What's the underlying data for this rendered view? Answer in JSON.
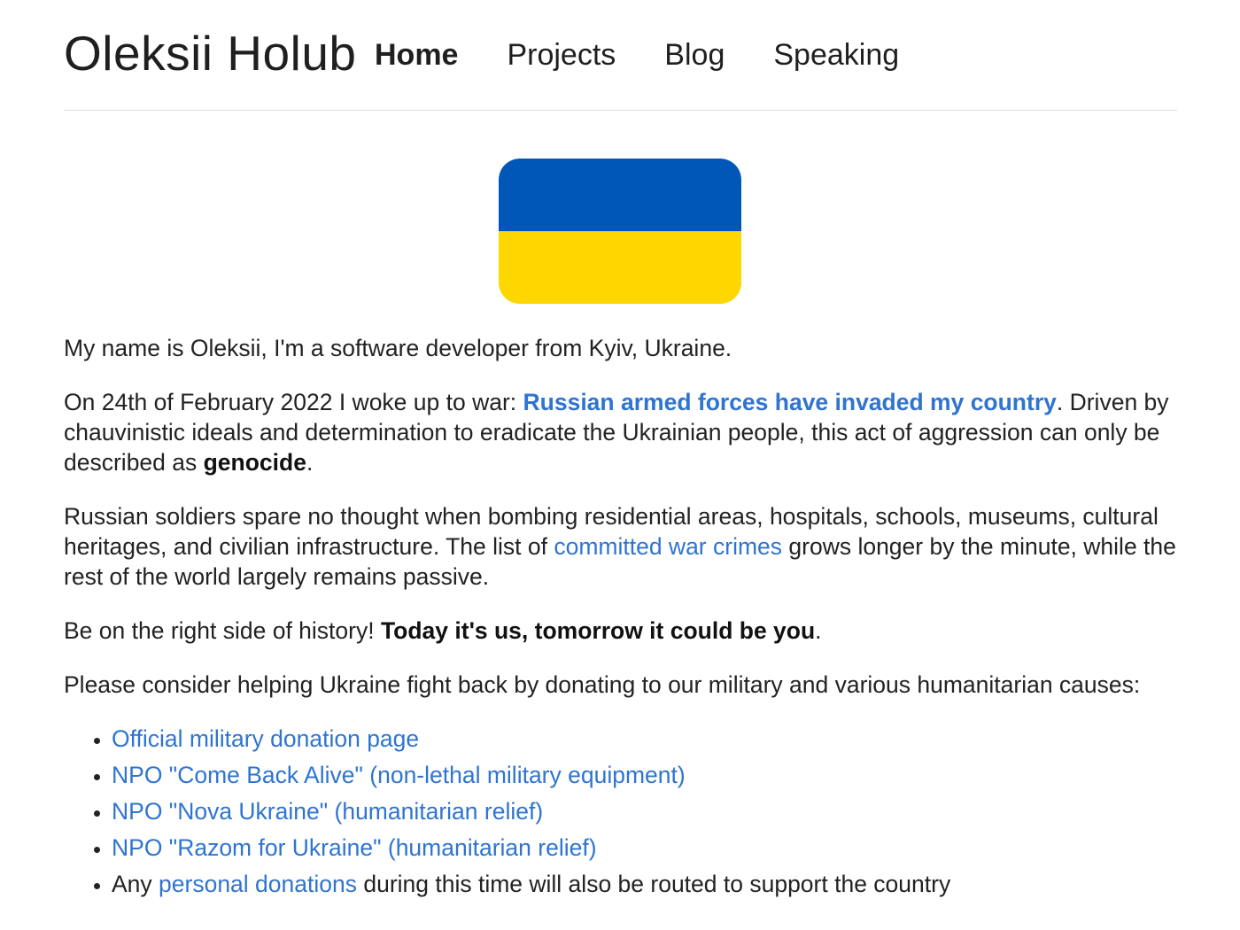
{
  "header": {
    "site_title": "Oleksii Holub",
    "nav": [
      {
        "label": "Home",
        "active": true
      },
      {
        "label": "Projects",
        "active": false
      },
      {
        "label": "Blog",
        "active": false
      },
      {
        "label": "Speaking",
        "active": false
      }
    ]
  },
  "flag": {
    "top_color": "#0057b8",
    "bottom_color": "#ffd700"
  },
  "colors": {
    "link": "#2f74d0",
    "text": "#222222"
  },
  "intro": "My name is Oleksii, I'm a software developer from Kyiv, Ukraine.",
  "war_paragraph": {
    "before": "On 24th of February 2022 I woke up to war: ",
    "link": "Russian armed forces have invaded my country",
    "after": ". Driven by chauvinistic ideals and determination to eradicate the Ukrainian people, this act of aggression can only be described as ",
    "bold": "genocide",
    "end": "."
  },
  "crimes_paragraph": {
    "before": "Russian soldiers spare no thought when bombing residential areas, hospitals, schools, museums, cultural heritages, and civilian infrastructure. The list of ",
    "link": "committed war crimes",
    "after": " grows longer by the minute, while the rest of the world largely remains passive."
  },
  "history_paragraph": {
    "before": "Be on the right side of history! ",
    "bold": "Today it's us, tomorrow it could be you",
    "end": "."
  },
  "help_paragraph": "Please consider helping Ukraine fight back by donating to our military and various humanitarian causes:",
  "donations": {
    "items": [
      "Official military donation page",
      "NPO \"Come Back Alive\" (non-lethal military equipment)",
      "NPO \"Nova Ukraine\" (humanitarian relief)",
      "NPO \"Razom for Ukraine\" (humanitarian relief)"
    ],
    "personal": {
      "before": "Any ",
      "link": "personal donations",
      "after": " during this time will also be routed to support the country"
    }
  }
}
